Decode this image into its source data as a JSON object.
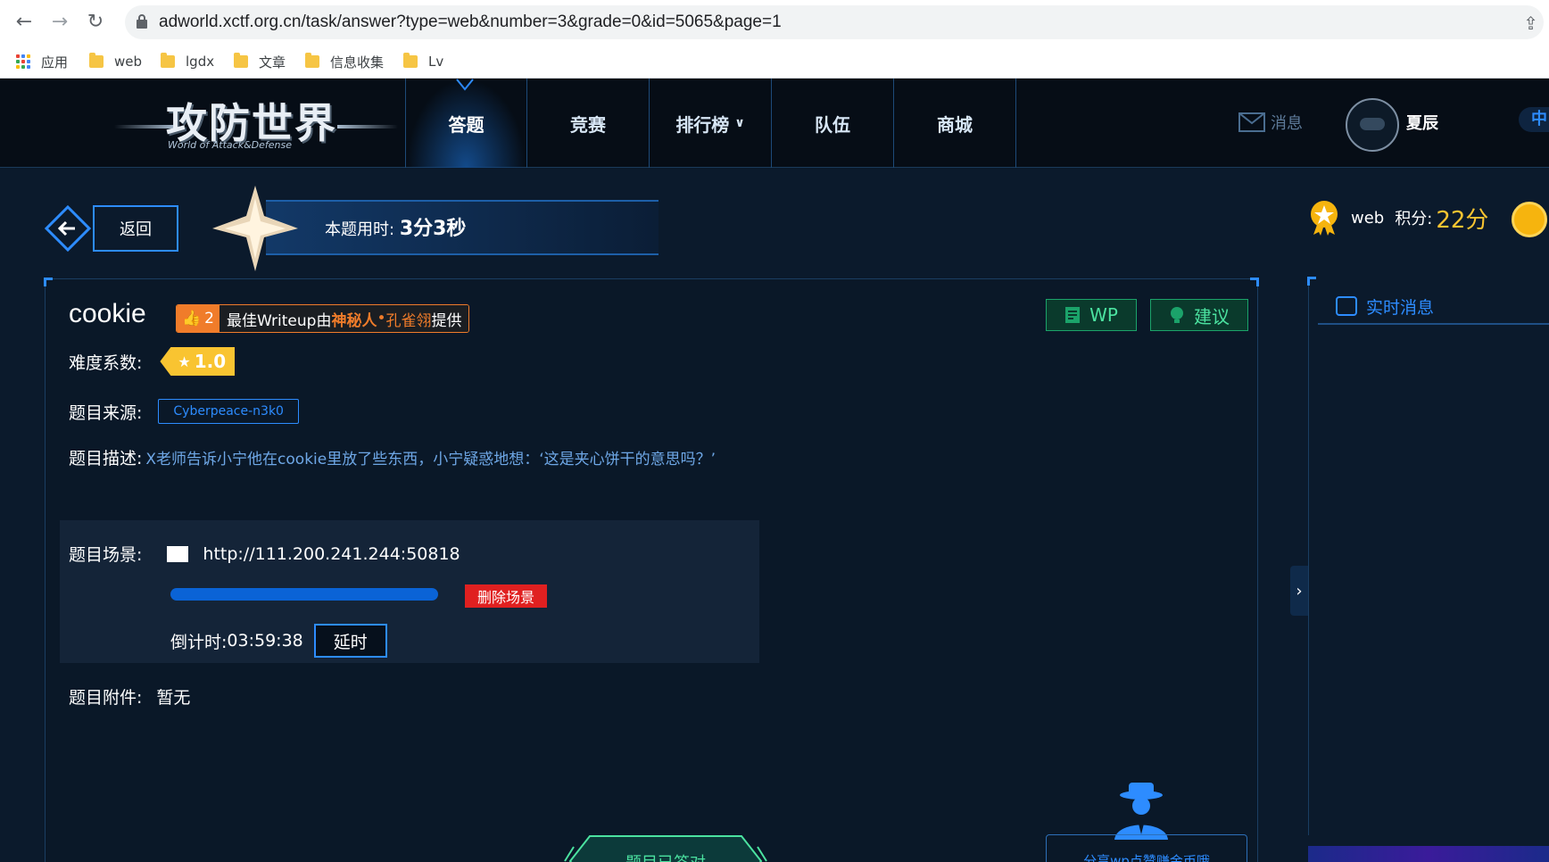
{
  "browser": {
    "url": "adworld.xctf.org.cn/task/answer?type=web&number=3&grade=0&id=5065&page=1",
    "bookmarks": [
      {
        "label": "应用",
        "type": "apps"
      },
      {
        "label": "web",
        "type": "folder"
      },
      {
        "label": "lgdx",
        "type": "folder"
      },
      {
        "label": "文章",
        "type": "folder"
      },
      {
        "label": "信息收集",
        "type": "folder"
      },
      {
        "label": "Lv",
        "type": "folder"
      }
    ]
  },
  "header": {
    "logo_title": "攻防世界",
    "logo_sub": "World of Attack&Defense",
    "nav": [
      {
        "label": "答题",
        "active": true
      },
      {
        "label": "竞赛",
        "active": false
      },
      {
        "label": "排行榜",
        "active": false
      },
      {
        "label": "队伍",
        "active": false
      },
      {
        "label": "商城",
        "active": false
      }
    ],
    "messages_label": "消息",
    "username": "夏辰",
    "lang": "中"
  },
  "topbar": {
    "back_label": "返回",
    "timer_label": "本题用时:",
    "timer_value": "3分3秒",
    "category": "web",
    "score_label": "积分:",
    "score_value": "22分"
  },
  "task": {
    "title": "cookie",
    "writeup_count": "2",
    "writeup_prefix": "最佳Writeup由",
    "writeup_author": "神秘人",
    "writeup_sep": " • ",
    "writeup_author2": "孔雀翎",
    "writeup_suffix": "提供",
    "wp_label": "WP",
    "suggest_label": "建议",
    "difficulty_label": "难度系数:",
    "difficulty_value": "1.0",
    "source_label": "题目来源:",
    "source_value": "Cyberpeace-n3k0",
    "desc_label": "题目描述:",
    "desc_value": "X老师告诉小宁他在cookie里放了些东西，小宁疑惑地想：‘这是夹心饼干的意思吗？’",
    "scene_label": "题目场景:",
    "scene_url": "http://111.200.241.244:50818",
    "delete_label": "删除场景",
    "countdown_label": "倒计时:",
    "countdown_value": "03:59:38",
    "delay_label": "延时",
    "attach_label": "题目附件:",
    "attach_value": "暂无",
    "answered_label": "题目已答对",
    "share_label": "分享wp点赞赚金币哦"
  },
  "sidebar": {
    "title": "实时消息"
  },
  "colors": {
    "accent": "#2d8cff",
    "gold": "#f9c431",
    "orange": "#f07c2a",
    "green": "#4be2a0",
    "danger": "#e02020"
  }
}
